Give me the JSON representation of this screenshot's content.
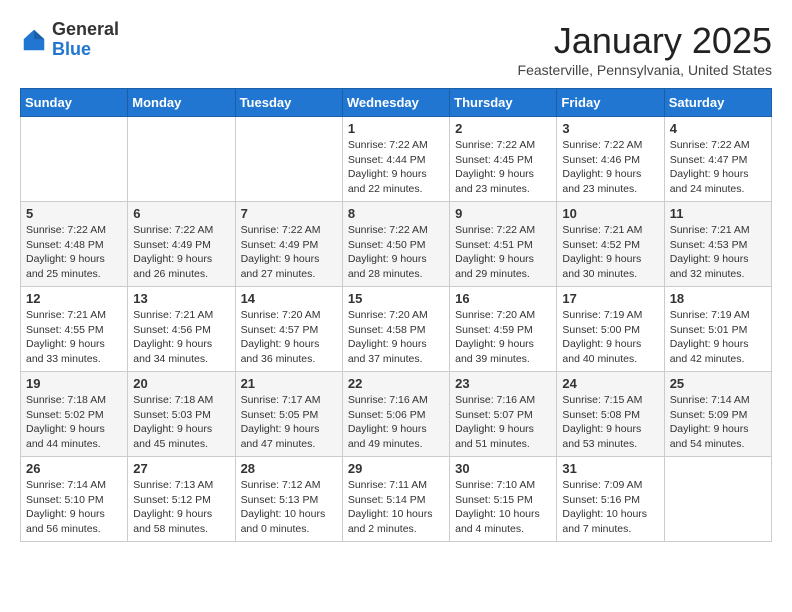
{
  "header": {
    "logo": {
      "general": "General",
      "blue": "Blue"
    },
    "title": "January 2025",
    "location": "Feasterville, Pennsylvania, United States"
  },
  "days_of_week": [
    "Sunday",
    "Monday",
    "Tuesday",
    "Wednesday",
    "Thursday",
    "Friday",
    "Saturday"
  ],
  "weeks": [
    [
      {
        "day": "",
        "info": ""
      },
      {
        "day": "",
        "info": ""
      },
      {
        "day": "",
        "info": ""
      },
      {
        "day": "1",
        "info": "Sunrise: 7:22 AM\nSunset: 4:44 PM\nDaylight: 9 hours\nand 22 minutes."
      },
      {
        "day": "2",
        "info": "Sunrise: 7:22 AM\nSunset: 4:45 PM\nDaylight: 9 hours\nand 23 minutes."
      },
      {
        "day": "3",
        "info": "Sunrise: 7:22 AM\nSunset: 4:46 PM\nDaylight: 9 hours\nand 23 minutes."
      },
      {
        "day": "4",
        "info": "Sunrise: 7:22 AM\nSunset: 4:47 PM\nDaylight: 9 hours\nand 24 minutes."
      }
    ],
    [
      {
        "day": "5",
        "info": "Sunrise: 7:22 AM\nSunset: 4:48 PM\nDaylight: 9 hours\nand 25 minutes."
      },
      {
        "day": "6",
        "info": "Sunrise: 7:22 AM\nSunset: 4:49 PM\nDaylight: 9 hours\nand 26 minutes."
      },
      {
        "day": "7",
        "info": "Sunrise: 7:22 AM\nSunset: 4:49 PM\nDaylight: 9 hours\nand 27 minutes."
      },
      {
        "day": "8",
        "info": "Sunrise: 7:22 AM\nSunset: 4:50 PM\nDaylight: 9 hours\nand 28 minutes."
      },
      {
        "day": "9",
        "info": "Sunrise: 7:22 AM\nSunset: 4:51 PM\nDaylight: 9 hours\nand 29 minutes."
      },
      {
        "day": "10",
        "info": "Sunrise: 7:21 AM\nSunset: 4:52 PM\nDaylight: 9 hours\nand 30 minutes."
      },
      {
        "day": "11",
        "info": "Sunrise: 7:21 AM\nSunset: 4:53 PM\nDaylight: 9 hours\nand 32 minutes."
      }
    ],
    [
      {
        "day": "12",
        "info": "Sunrise: 7:21 AM\nSunset: 4:55 PM\nDaylight: 9 hours\nand 33 minutes."
      },
      {
        "day": "13",
        "info": "Sunrise: 7:21 AM\nSunset: 4:56 PM\nDaylight: 9 hours\nand 34 minutes."
      },
      {
        "day": "14",
        "info": "Sunrise: 7:20 AM\nSunset: 4:57 PM\nDaylight: 9 hours\nand 36 minutes."
      },
      {
        "day": "15",
        "info": "Sunrise: 7:20 AM\nSunset: 4:58 PM\nDaylight: 9 hours\nand 37 minutes."
      },
      {
        "day": "16",
        "info": "Sunrise: 7:20 AM\nSunset: 4:59 PM\nDaylight: 9 hours\nand 39 minutes."
      },
      {
        "day": "17",
        "info": "Sunrise: 7:19 AM\nSunset: 5:00 PM\nDaylight: 9 hours\nand 40 minutes."
      },
      {
        "day": "18",
        "info": "Sunrise: 7:19 AM\nSunset: 5:01 PM\nDaylight: 9 hours\nand 42 minutes."
      }
    ],
    [
      {
        "day": "19",
        "info": "Sunrise: 7:18 AM\nSunset: 5:02 PM\nDaylight: 9 hours\nand 44 minutes."
      },
      {
        "day": "20",
        "info": "Sunrise: 7:18 AM\nSunset: 5:03 PM\nDaylight: 9 hours\nand 45 minutes."
      },
      {
        "day": "21",
        "info": "Sunrise: 7:17 AM\nSunset: 5:05 PM\nDaylight: 9 hours\nand 47 minutes."
      },
      {
        "day": "22",
        "info": "Sunrise: 7:16 AM\nSunset: 5:06 PM\nDaylight: 9 hours\nand 49 minutes."
      },
      {
        "day": "23",
        "info": "Sunrise: 7:16 AM\nSunset: 5:07 PM\nDaylight: 9 hours\nand 51 minutes."
      },
      {
        "day": "24",
        "info": "Sunrise: 7:15 AM\nSunset: 5:08 PM\nDaylight: 9 hours\nand 53 minutes."
      },
      {
        "day": "25",
        "info": "Sunrise: 7:14 AM\nSunset: 5:09 PM\nDaylight: 9 hours\nand 54 minutes."
      }
    ],
    [
      {
        "day": "26",
        "info": "Sunrise: 7:14 AM\nSunset: 5:10 PM\nDaylight: 9 hours\nand 56 minutes."
      },
      {
        "day": "27",
        "info": "Sunrise: 7:13 AM\nSunset: 5:12 PM\nDaylight: 9 hours\nand 58 minutes."
      },
      {
        "day": "28",
        "info": "Sunrise: 7:12 AM\nSunset: 5:13 PM\nDaylight: 10 hours\nand 0 minutes."
      },
      {
        "day": "29",
        "info": "Sunrise: 7:11 AM\nSunset: 5:14 PM\nDaylight: 10 hours\nand 2 minutes."
      },
      {
        "day": "30",
        "info": "Sunrise: 7:10 AM\nSunset: 5:15 PM\nDaylight: 10 hours\nand 4 minutes."
      },
      {
        "day": "31",
        "info": "Sunrise: 7:09 AM\nSunset: 5:16 PM\nDaylight: 10 hours\nand 7 minutes."
      },
      {
        "day": "",
        "info": ""
      }
    ]
  ]
}
